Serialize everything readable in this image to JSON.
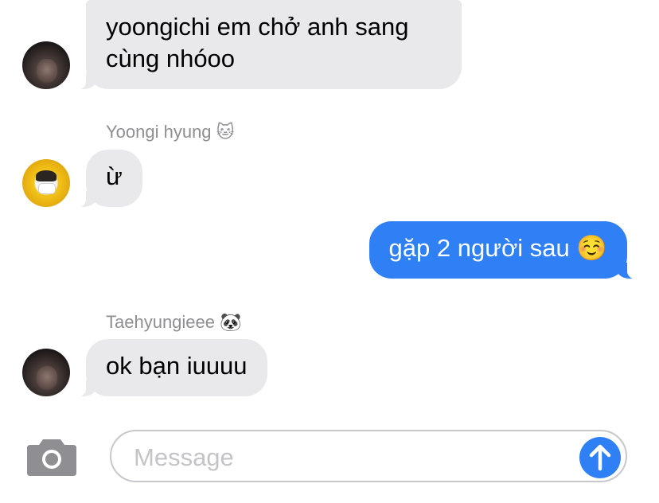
{
  "messages": [
    {
      "sender": "",
      "side": "left",
      "text": "yoongichi em chở anh sang cùng nhóoo"
    },
    {
      "sender": "Yoongi hyung 🐱",
      "side": "left",
      "text": "ừ"
    },
    {
      "sender": "",
      "side": "right",
      "text": "gặp 2 người sau ☺️"
    },
    {
      "sender": "Taehyungieee 🐼",
      "side": "left",
      "text": "ok bạn iuuuu"
    }
  ],
  "compose": {
    "placeholder": "Message"
  },
  "icons": {
    "camera": "camera-icon",
    "send": "arrow-up-icon"
  },
  "colors": {
    "incoming_bubble": "#e9e9eb",
    "outgoing_bubble": "#2f80f5",
    "sender_label": "#8e8e93"
  }
}
